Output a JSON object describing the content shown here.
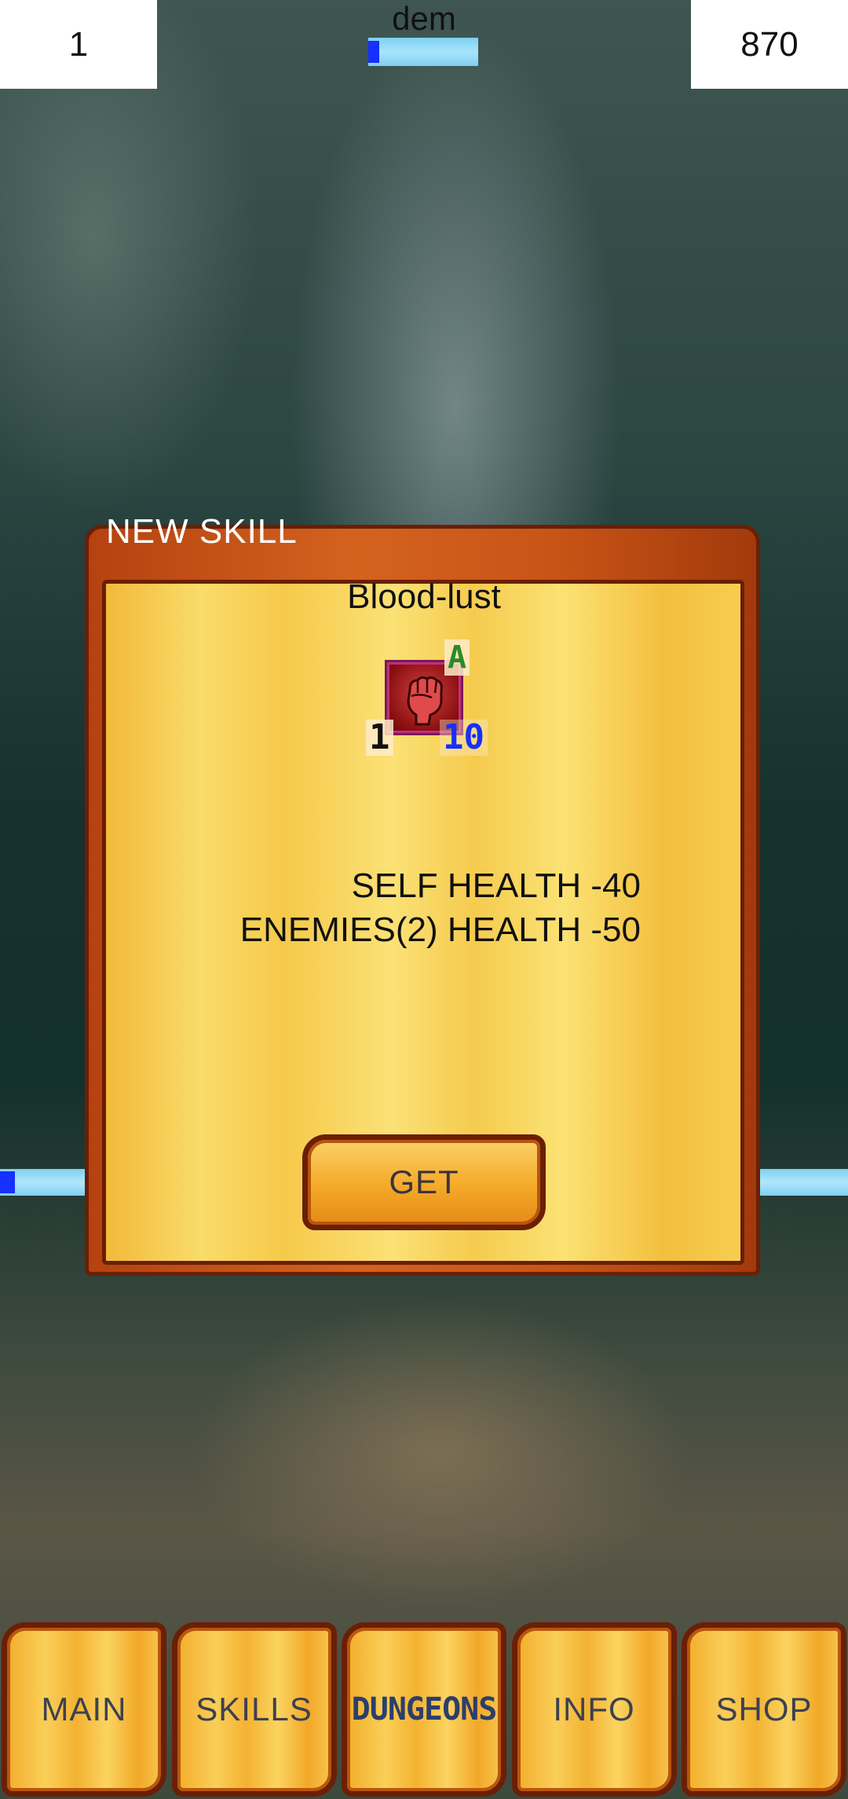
{
  "hud": {
    "level": "1",
    "player_name": "dem",
    "gold": "870",
    "player_health_fraction": 0.1
  },
  "side_bar": {
    "enemy_health_fraction": 0.16
  },
  "dialog": {
    "title": "NEW SKILL",
    "skill_name": "Blood-lust",
    "skill_icon": "clenched-fist-icon",
    "skill_type": "A",
    "skill_level": "1",
    "skill_cost": "10",
    "effects": [
      "SELF HEALTH -40",
      "ENEMIES(2) HEALTH -50"
    ],
    "get_label": "GET"
  },
  "nav": {
    "items": [
      {
        "label": "MAIN"
      },
      {
        "label": "SKILLS"
      },
      {
        "label": "DUNGEONS"
      },
      {
        "label": "INFO"
      },
      {
        "label": "SHOP"
      }
    ]
  },
  "colors": {
    "health_fill": "#1530ff",
    "health_track": "#8fd8f5",
    "dialog_frame": "#c85416",
    "dialog_panel": "#f9dc6a",
    "skill_type_color": "#2a8a2a",
    "skill_cost_color": "#1530ff"
  }
}
